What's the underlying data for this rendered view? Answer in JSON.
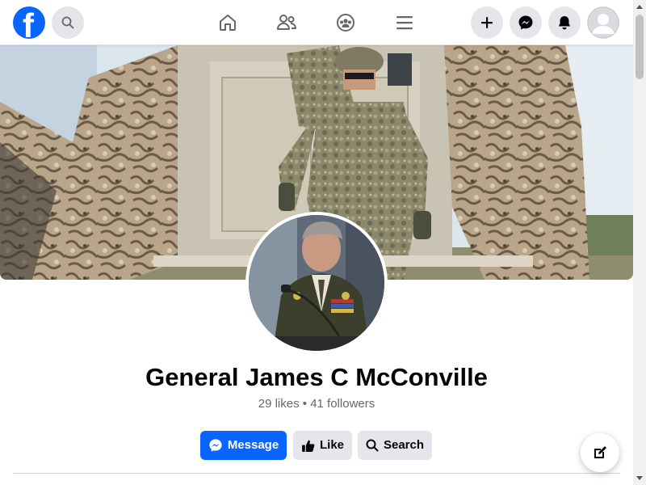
{
  "nav": {
    "logo_icon": "facebook-logo-icon",
    "logo_glyph": "f",
    "search_icon": "search-icon",
    "center_icons": [
      "home-icon",
      "friends-icon",
      "groups-icon",
      "menu-icon"
    ],
    "right_icons": [
      "plus-icon",
      "messenger-icon",
      "bell-icon",
      "avatar-icon"
    ]
  },
  "profile": {
    "name": "General James C McConville",
    "stats": "29 likes • 41 followers"
  },
  "actions": {
    "message_label": "Message",
    "like_label": "Like",
    "search_label": "Search"
  },
  "colors": {
    "brand": "#0866ff",
    "secondary_button": "#e4e6eb",
    "text": "#050505",
    "muted": "#65676b"
  },
  "fab": {
    "icon": "compose-icon"
  }
}
